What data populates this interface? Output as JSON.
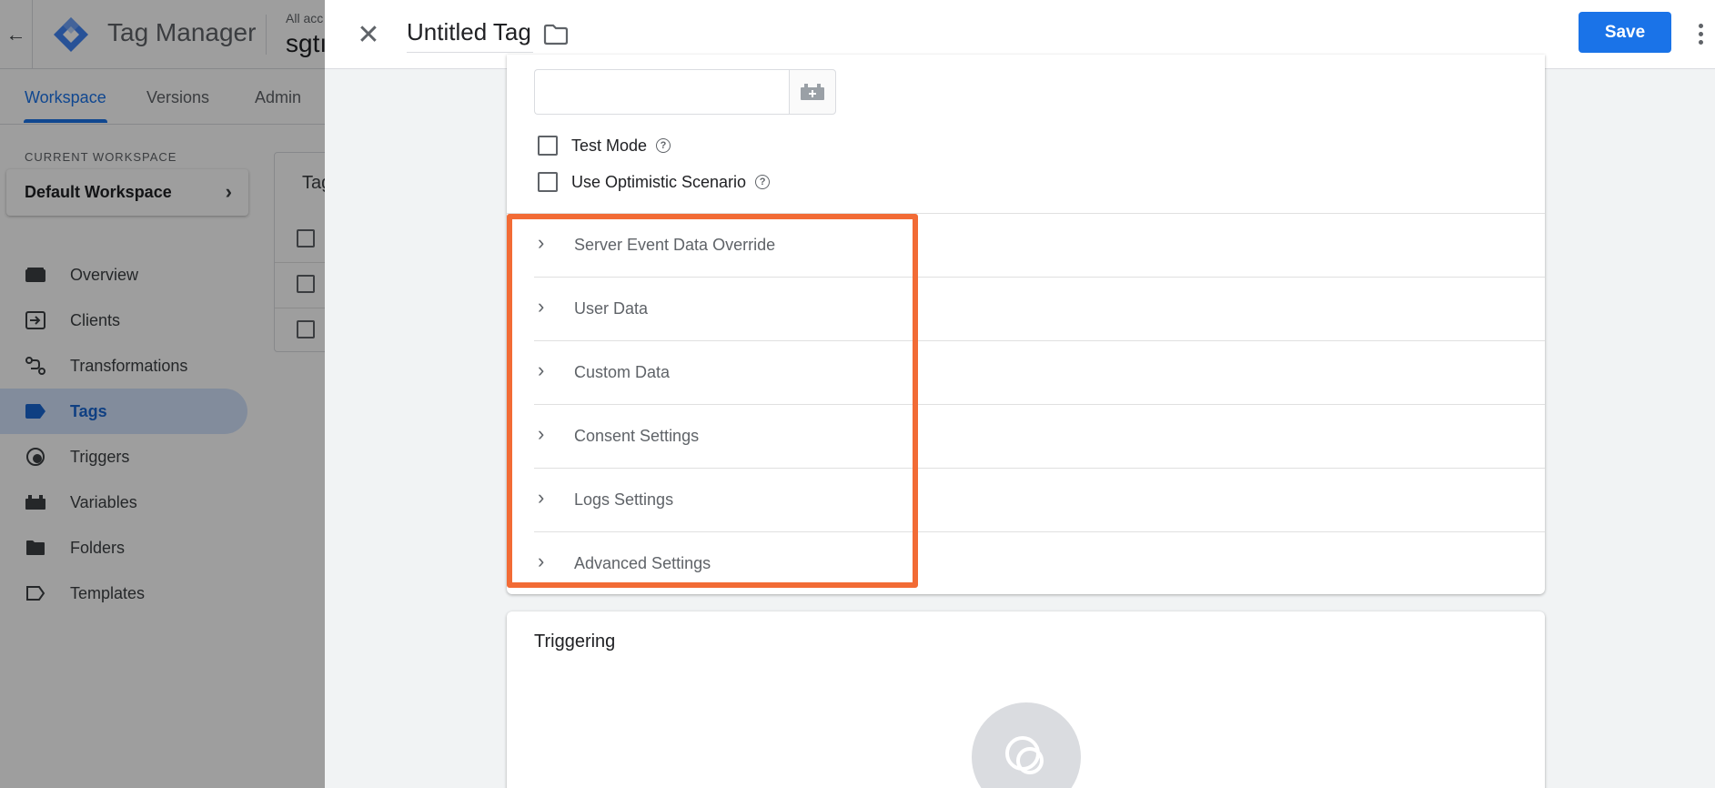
{
  "app": {
    "title": "Tag Manager",
    "account_label": "All acc",
    "container_name": "sgtı",
    "tabs": [
      {
        "label": "Workspace",
        "active": true
      },
      {
        "label": "Versions",
        "active": false
      },
      {
        "label": "Admin",
        "active": false
      }
    ],
    "workspace": {
      "label": "CURRENT WORKSPACE",
      "name": "Default Workspace"
    },
    "nav": [
      {
        "label": "Overview",
        "icon": "overview-icon",
        "active": false
      },
      {
        "label": "Clients",
        "icon": "clients-icon",
        "active": false
      },
      {
        "label": "Transformations",
        "icon": "transformations-icon",
        "active": false
      },
      {
        "label": "Tags",
        "icon": "tag-icon",
        "active": true
      },
      {
        "label": "Triggers",
        "icon": "triggers-icon",
        "active": false
      },
      {
        "label": "Variables",
        "icon": "variables-icon",
        "active": false
      },
      {
        "label": "Folders",
        "icon": "folder-icon",
        "active": false
      },
      {
        "label": "Templates",
        "icon": "templates-icon",
        "active": false
      }
    ],
    "tags_card_title": "Tag"
  },
  "sheet": {
    "tag_name": "Untitled Tag",
    "save_label": "Save",
    "checkboxes": [
      {
        "label": "Test Mode",
        "checked": false
      },
      {
        "label": "Use Optimistic Scenario",
        "checked": false
      }
    ],
    "sections": [
      {
        "label": "Server Event Data Override"
      },
      {
        "label": "User Data"
      },
      {
        "label": "Custom Data"
      },
      {
        "label": "Consent Settings"
      },
      {
        "label": "Logs Settings"
      },
      {
        "label": "Advanced Settings"
      }
    ],
    "triggering_title": "Triggering"
  },
  "colors": {
    "accent": "#1a73e8",
    "highlight": "#f26b35",
    "nav_active_bg": "#d2e3fc"
  }
}
